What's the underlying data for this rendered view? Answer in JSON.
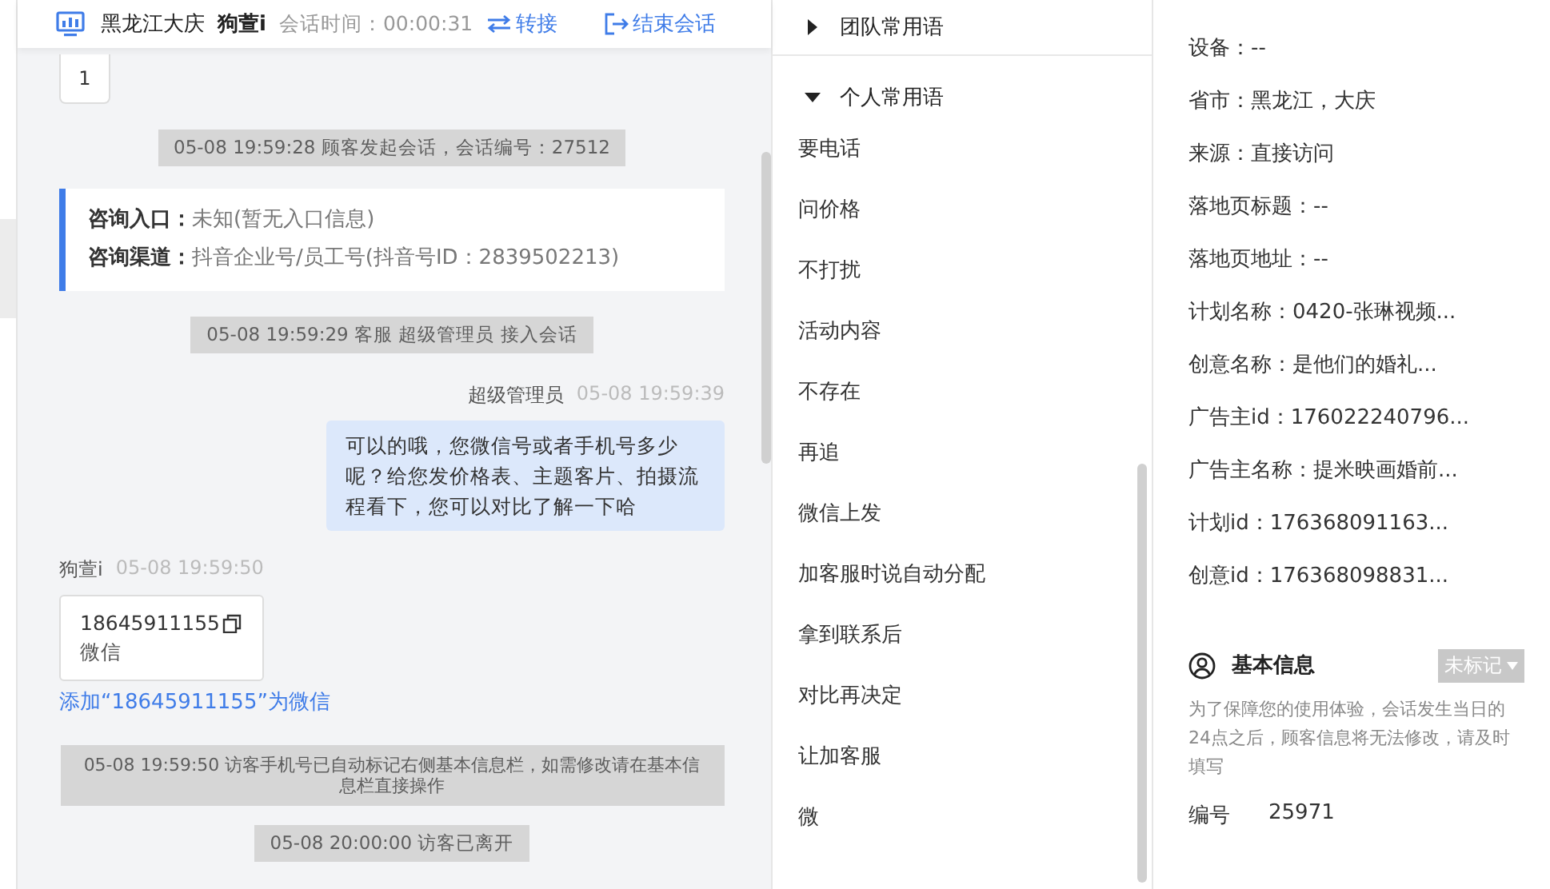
{
  "header": {
    "location": "黑龙江大庆",
    "visitor": "狗萱i",
    "session_time": "会话时间：00:00:31",
    "transfer_button": "转接",
    "end_button": "结束会话"
  },
  "chat": {
    "items": [
      {
        "kind": "bubble",
        "text": "1"
      },
      {
        "kind": "system",
        "text": "05-08 19:59:28 顾客发起会话，会话编号：27512"
      },
      {
        "kind": "info",
        "rows": [
          {
            "label": "咨询入口：",
            "value": "未知(暂无入口信息)"
          },
          {
            "label": "咨询渠道：",
            "value": "抖音企业号/员工号(抖音号ID：2839502213)"
          }
        ]
      },
      {
        "kind": "system",
        "text": "05-08 19:59:29 客服 超级管理员 接入会话"
      },
      {
        "kind": "outgoing",
        "sender": "超级管理员",
        "time": "05-08 19:59:39",
        "text": "可以的哦，您微信号或者手机号多少呢？给您发价格表、主题客片、拍摄流程看下，您可以对比了解一下哈"
      },
      {
        "kind": "incoming",
        "sender": "狗萱i",
        "time": "05-08 19:59:50",
        "number": "18645911155",
        "number_type": "微信"
      },
      {
        "kind": "link",
        "text": "添加“18645911155”为微信"
      },
      {
        "kind": "system",
        "text": "05-08 19:59:50 访客手机号已自动标记右侧基本信息栏，如需修改请在基本信息栏直接操作"
      },
      {
        "kind": "system",
        "text": "05-08 20:00:00 访客已离开"
      }
    ]
  },
  "phrases": {
    "groups": [
      {
        "title": "团队常用语",
        "expanded": false
      },
      {
        "title": "个人常用语",
        "expanded": true,
        "items": [
          "要电话",
          "问价格",
          "不打扰",
          "活动内容",
          "不存在",
          "再追",
          "微信上发",
          "加客服时说自动分配",
          "拿到联系后",
          "对比再决定",
          "让加客服",
          "微"
        ]
      }
    ]
  },
  "visitor_info": {
    "fields": [
      {
        "text": "设备：--"
      },
      {
        "text": "省市：黑龙江，大庆"
      },
      {
        "text": "来源：直接访问"
      },
      {
        "text": "落地页标题：--"
      },
      {
        "text": "落地页地址：--"
      },
      {
        "text": "计划名称：0420-张琳视频..."
      },
      {
        "text": "创意名称：是他们的婚礼..."
      },
      {
        "text": "广告主id：176022240796..."
      },
      {
        "text": "广告主名称：提米映画婚前..."
      },
      {
        "text": "计划id：176368091163..."
      },
      {
        "text": "创意id：176368098831..."
      }
    ]
  },
  "basic_info": {
    "title": "基本信息",
    "tag": "未标记",
    "notice": "为了保障您的使用体验，会话发生当日的24点之后，顾客信息将无法修改，请及时填写",
    "fields": [
      {
        "label": "编号",
        "value": "25971"
      }
    ]
  }
}
